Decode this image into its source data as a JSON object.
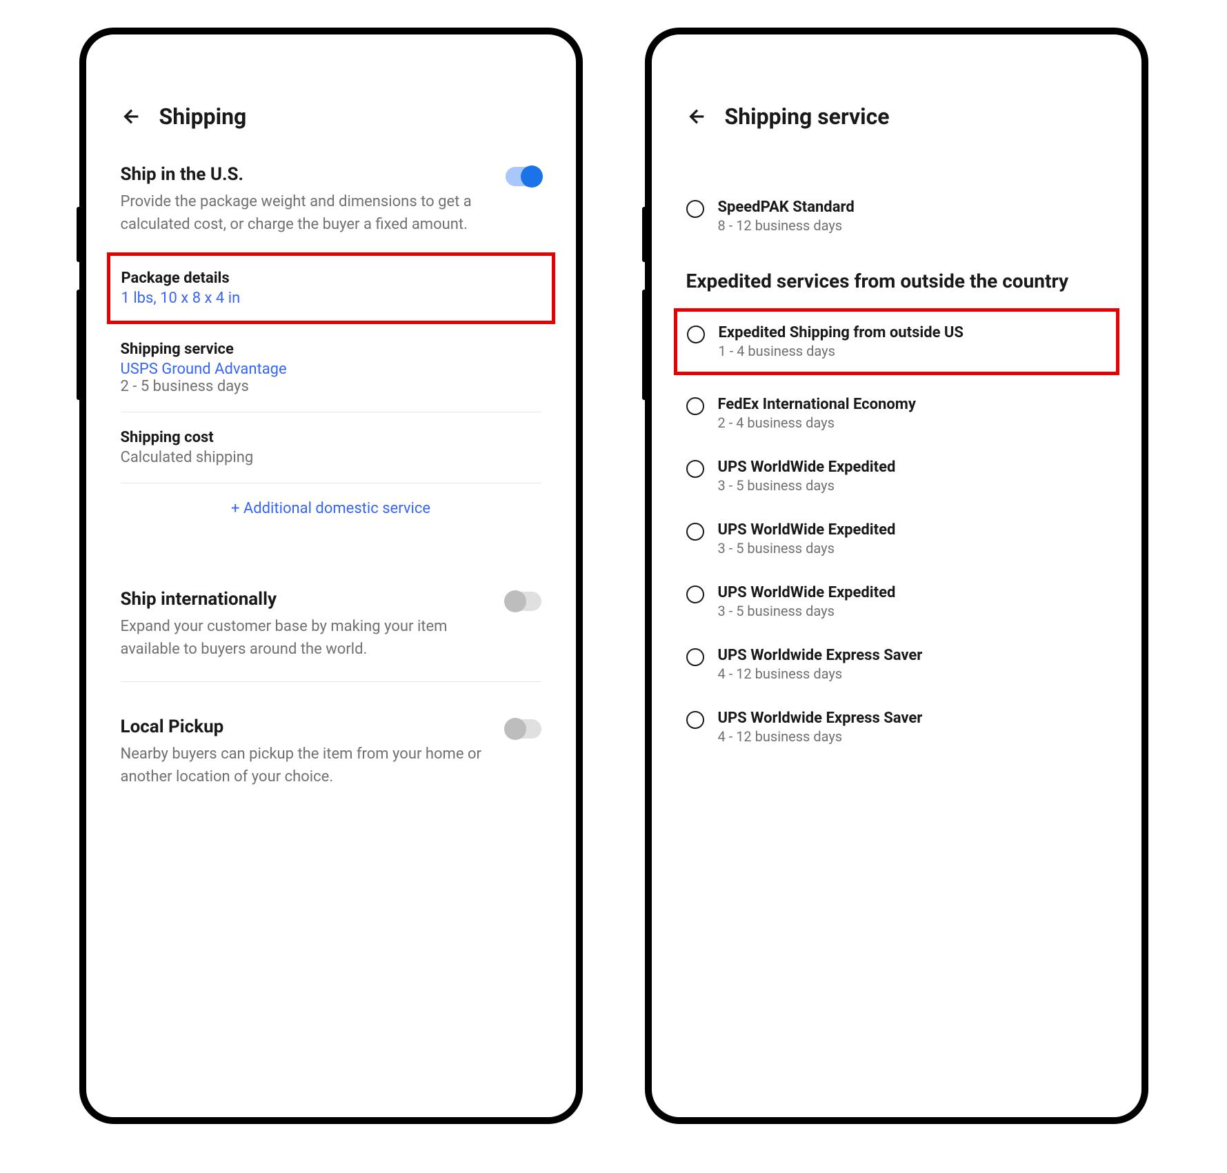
{
  "left": {
    "title": "Shipping",
    "ship_us": {
      "title": "Ship in the U.S.",
      "desc": "Provide the package weight and dimensions to get a calculated cost, or charge the buyer a fixed amount.",
      "toggle": true
    },
    "package": {
      "label": "Package details",
      "value": "1 lbs, 10 x 8 x 4 in"
    },
    "service": {
      "label": "Shipping service",
      "name": "USPS Ground Advantage",
      "eta": "2 - 5 business days"
    },
    "cost": {
      "label": "Shipping cost",
      "value": "Calculated shipping"
    },
    "add_link": "+ Additional domestic service",
    "intl": {
      "title": "Ship internationally",
      "desc": "Expand your customer base by making your item available to buyers around the world.",
      "toggle": false
    },
    "pickup": {
      "title": "Local Pickup",
      "desc": "Nearby buyers can pickup the item from your home or another location of your choice.",
      "toggle": false
    }
  },
  "right": {
    "title": "Shipping service",
    "top_option": {
      "name": "SpeedPAK Standard",
      "eta": "8 - 12 business days"
    },
    "group_header": "Expedited services from outside the country",
    "options": [
      {
        "name": "Expedited Shipping from outside US",
        "eta": "1 - 4 business days",
        "highlighted": true
      },
      {
        "name": "FedEx International Economy",
        "eta": "2 - 4 business days",
        "highlighted": false
      },
      {
        "name": "UPS WorldWide Expedited",
        "eta": "3 - 5 business days",
        "highlighted": false
      },
      {
        "name": "UPS WorldWide Expedited",
        "eta": "3 - 5 business days",
        "highlighted": false
      },
      {
        "name": "UPS WorldWide Expedited",
        "eta": "3 - 5 business days",
        "highlighted": false
      },
      {
        "name": "UPS Worldwide Express Saver",
        "eta": "4 - 12 business days",
        "highlighted": false
      },
      {
        "name": "UPS Worldwide Express Saver",
        "eta": "4 - 12 business days",
        "highlighted": false
      }
    ]
  }
}
